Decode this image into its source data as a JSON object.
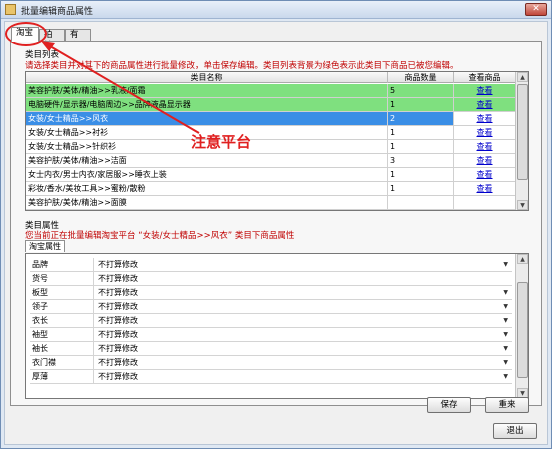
{
  "window": {
    "title": "批量编辑商品属性",
    "close_glyph": "✕"
  },
  "tabs": [
    {
      "label": "淘宝",
      "active": true
    },
    {
      "label": "拍拍",
      "active": false
    },
    {
      "label": "有啊",
      "active": false
    }
  ],
  "category_list": {
    "section_title": "类目列表",
    "hint": "请选择类目并对其下的商品属性进行批量修改，单击保存编辑。类目列表背景为绿色表示此类目下商品已被您编辑。",
    "columns": [
      "类目名称",
      "商品数量",
      "查看商品"
    ],
    "rows": [
      {
        "name": "美容护肤/美体/精油>>乳液/面霜",
        "count": "5",
        "link": "查看",
        "state": "edited"
      },
      {
        "name": "电脑硬件/显示器/电脑周边>>品牌液晶显示器",
        "count": "1",
        "link": "查看",
        "state": "edited"
      },
      {
        "name": "女装/女士精品>>风衣",
        "count": "2",
        "link": "查看",
        "state": "selected"
      },
      {
        "name": "女装/女士精品>>衬衫",
        "count": "1",
        "link": "查看",
        "state": "normal"
      },
      {
        "name": "女装/女士精品>>针织衫",
        "count": "1",
        "link": "查看",
        "state": "normal"
      },
      {
        "name": "美容护肤/美体/精油>>洁面",
        "count": "3",
        "link": "查看",
        "state": "normal"
      },
      {
        "name": "女士内衣/男士内衣/家居服>>睡衣上装",
        "count": "1",
        "link": "查看",
        "state": "normal"
      },
      {
        "name": "彩妆/香水/美妆工具>>蜜粉/散粉",
        "count": "1",
        "link": "查看",
        "state": "normal"
      },
      {
        "name": "美容护肤/美体/精油>>面膜",
        "count": "",
        "link": "",
        "state": "normal"
      }
    ],
    "colors": {
      "edited": "#7fe07f",
      "selected": "#3a8ee6",
      "link": "#0000cc"
    }
  },
  "category_attributes": {
    "section_title": "类目属性",
    "hint": "您当前正在批量编辑淘宝平台 “女装/女士精品>>风衣” 类目下商品属性",
    "subtab": "淘宝属性",
    "rows": [
      {
        "label": "品牌",
        "value": "不打算修改"
      },
      {
        "label": "货号",
        "value": "不打算修改"
      },
      {
        "label": "板型",
        "value": "不打算修改"
      },
      {
        "label": "领子",
        "value": "不打算修改"
      },
      {
        "label": "衣长",
        "value": "不打算修改"
      },
      {
        "label": "袖型",
        "value": "不打算修改"
      },
      {
        "label": "袖长",
        "value": "不打算修改"
      },
      {
        "label": "衣门襟",
        "value": "不打算修改"
      },
      {
        "label": "厚薄",
        "value": "不打算修改"
      }
    ]
  },
  "buttons": {
    "save": "保存",
    "reset": "重来",
    "exit": "退出"
  },
  "annotation": {
    "text": "注意平台",
    "color": "#e02020"
  }
}
